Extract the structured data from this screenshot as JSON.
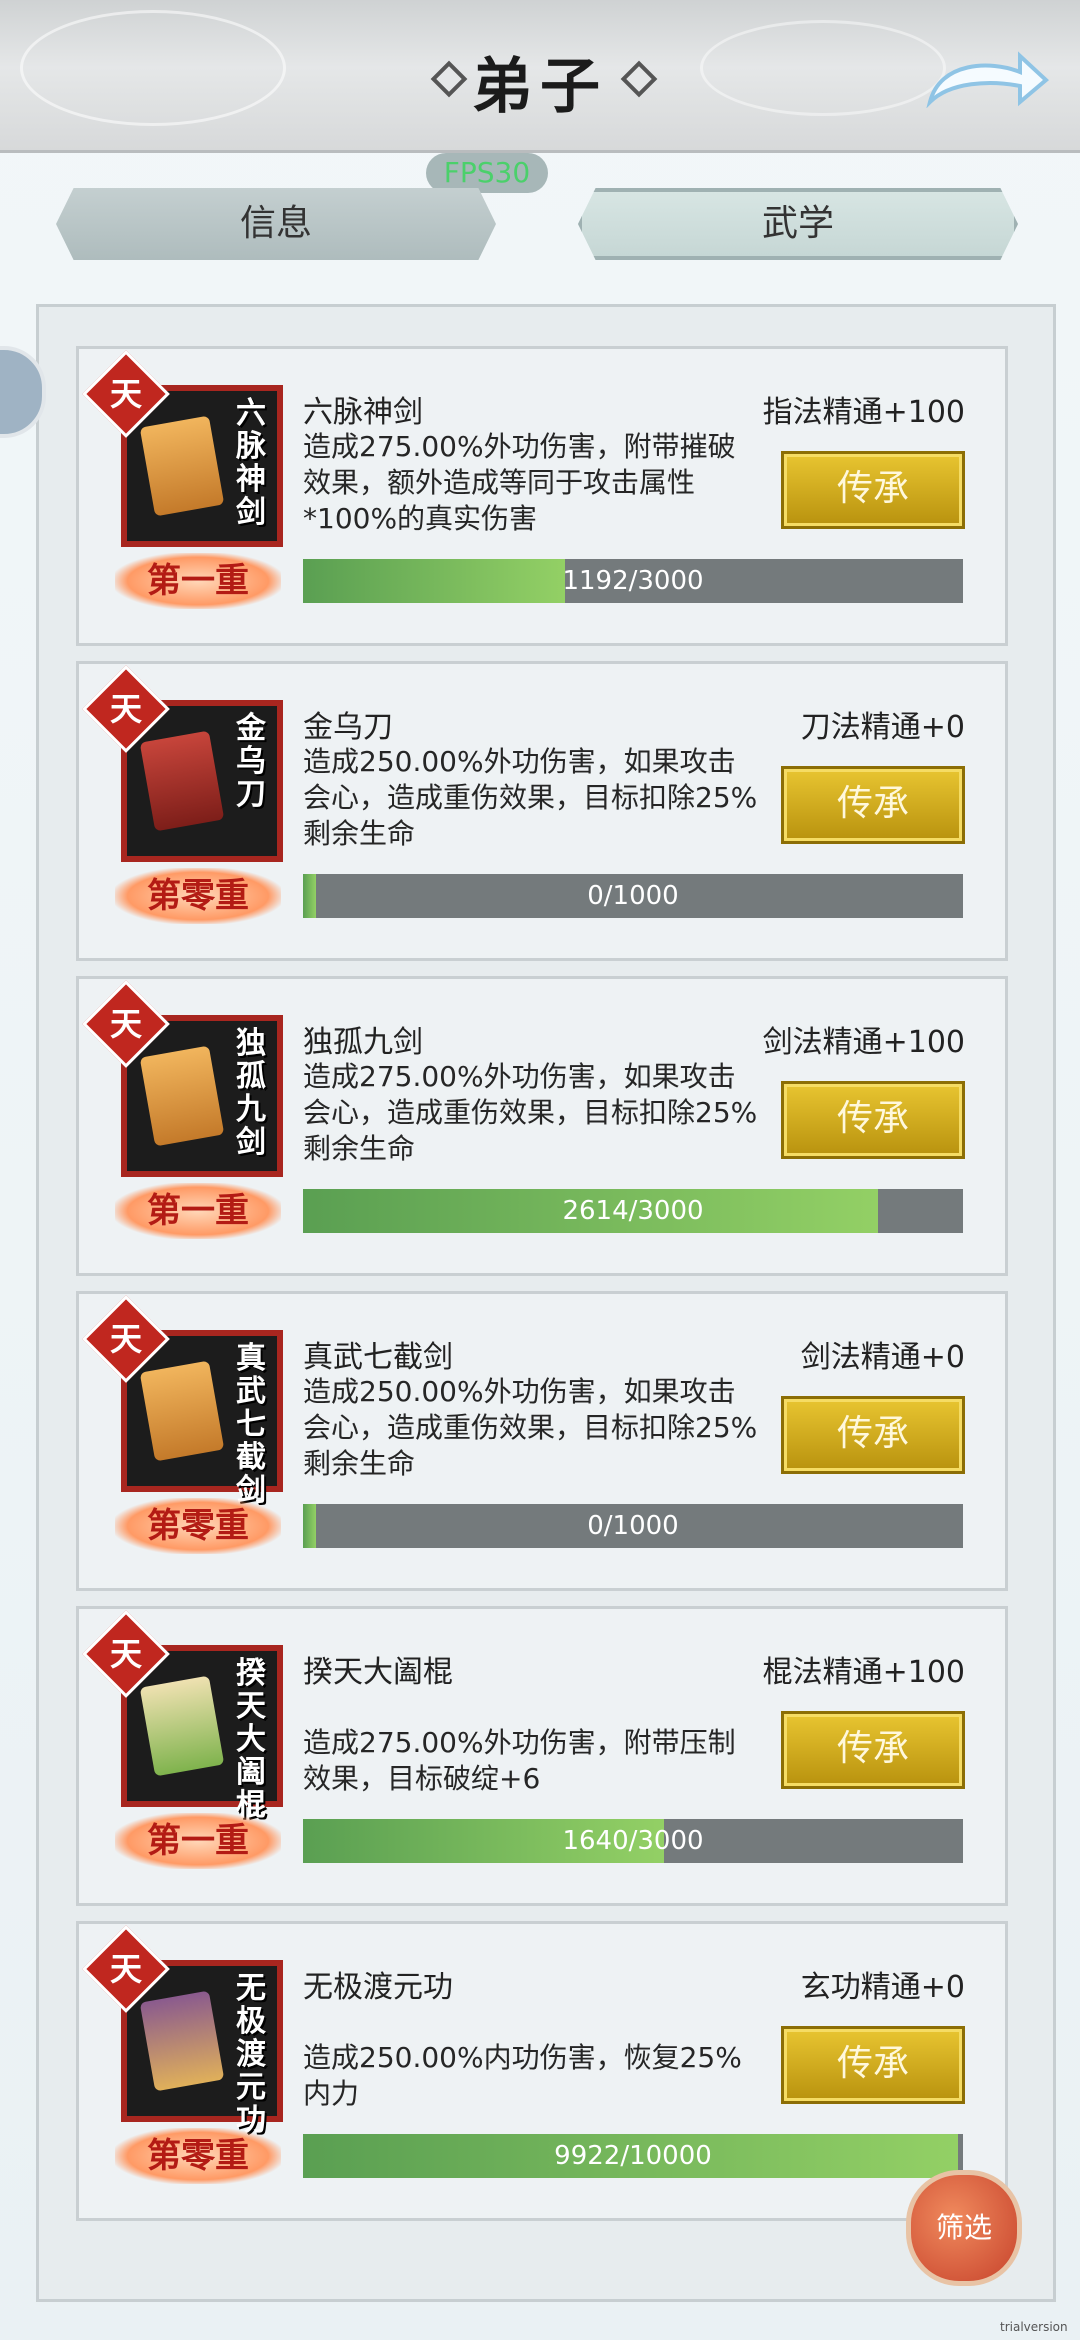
{
  "header": {
    "title": "弟子"
  },
  "fps": "FPS30",
  "tabs": [
    {
      "label": "信息",
      "active": false
    },
    {
      "label": "武学",
      "active": true
    }
  ],
  "skills": [
    {
      "tier": "天",
      "name": "六脉神剑",
      "icon_name": "六脉神剑",
      "mastery": "指法精通+100",
      "desc": "造成275.00%外功伤害，附带摧破效果，额外造成等同于攻击属性*100%的真实伤害",
      "level": "第一重",
      "button": "传承",
      "progress_text": "1192/3000",
      "progress": 0.397
    },
    {
      "tier": "天",
      "name": "金乌刀",
      "icon_name": "金乌刀",
      "mastery": "刀法精通+0",
      "desc": "造成250.00%外功伤害，如果攻击会心，造成重伤效果，目标扣除25%剩余生命",
      "level": "第零重",
      "button": "传承",
      "progress_text": "0/1000",
      "progress": 0.02
    },
    {
      "tier": "天",
      "name": "独孤九剑",
      "icon_name": "独孤九剑",
      "mastery": "剑法精通+100",
      "desc": "造成275.00%外功伤害，如果攻击会心，造成重伤效果，目标扣除25%剩余生命",
      "level": "第一重",
      "button": "传承",
      "progress_text": "2614/3000",
      "progress": 0.871
    },
    {
      "tier": "天",
      "name": "真武七截剑",
      "icon_name": "真武七截剑",
      "mastery": "剑法精通+0",
      "desc": "造成250.00%外功伤害，如果攻击会心，造成重伤效果，目标扣除25%剩余生命",
      "level": "第零重",
      "button": "传承",
      "progress_text": "0/1000",
      "progress": 0.02
    },
    {
      "tier": "天",
      "name": "揆天大阖棍",
      "icon_name": "揆天大阖棍",
      "mastery": "棍法精通+100",
      "desc": "造成275.00%外功伤害，附带压制效果，目标破绽+6",
      "level": "第一重",
      "button": "传承",
      "progress_text": "1640/3000",
      "progress": 0.547
    },
    {
      "tier": "天",
      "name": "无极渡元功",
      "icon_name": "无极渡元功",
      "mastery": "玄功精通+0",
      "desc": "造成250.00%内功伤害，恢复25%内力",
      "level": "第零重",
      "button": "传承",
      "progress_text": "9922/10000",
      "progress": 0.992
    }
  ],
  "filter": "筛选",
  "watermark": "trialversion",
  "icons": {
    "back": "back-arrow-icon",
    "tier": "tier-diamond-icon"
  },
  "colors": {
    "accent_gold": "#d4af22",
    "progress_green": "#6fb65a",
    "tier_red": "#c0271f"
  }
}
